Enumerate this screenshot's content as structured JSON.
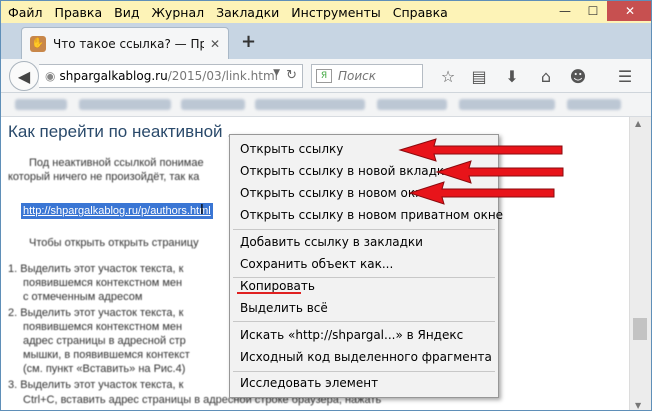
{
  "menubar": {
    "items": [
      "Файл",
      "Правка",
      "Вид",
      "Журнал",
      "Закладки",
      "Инструменты",
      "Справка"
    ]
  },
  "window_controls": {
    "minimize": "—",
    "maximize": "☐",
    "close": "✕"
  },
  "tab": {
    "title": "Что такое ссылка? — При...",
    "favicon": "✋"
  },
  "navbar": {
    "url_domain": "shpargalkablog.ru",
    "url_path": "/2015/03/link.html",
    "search_placeholder": "Поиск"
  },
  "article": {
    "heading": "Как перейти по неактивной ...",
    "para1_line1": "Под неактивной ссылкой понимае",
    "para1_line2": "который ничего не произойдёт, так ка",
    "selected_link": "http://shpargalkablog.ru/p/authors.html",
    "para2": "Чтобы открыть открыть страницу",
    "list": [
      "1. Выделить этот участок текста, к",
      "появившемся контекстном мен",
      "с отмеченным адресом",
      "2. Выделить этот участок текста, к",
      "появившемся контекстном мен",
      "адрес страницы в адресной стр",
      "мышки, в появившемся контекст",
      "(см. пункт «Вставить» на Рис.4)",
      "3. Выделить этот участок текста, к",
      "Ctrl+C, вставить адрес страницы в адресной строке браузера, нажать"
    ]
  },
  "context_menu": {
    "items": [
      "Открыть ссылку",
      "Открыть ссылку в новой вкладке",
      "Открыть ссылку в новом окне",
      "Открыть ссылку в новом приватном окне",
      "Добавить ссылку в закладки",
      "Сохранить объект как...",
      "Копировать",
      "Выделить всё",
      "Искать «http://shpargal...» в Яндекс",
      "Исходный код выделенного фрагмента",
      "Исследовать элемент"
    ]
  },
  "colors": {
    "menubar_bg": "#fdf3b7",
    "selection": "#3a76d4",
    "arrow_red": "#e8141a",
    "heading": "#2a4a6b"
  }
}
